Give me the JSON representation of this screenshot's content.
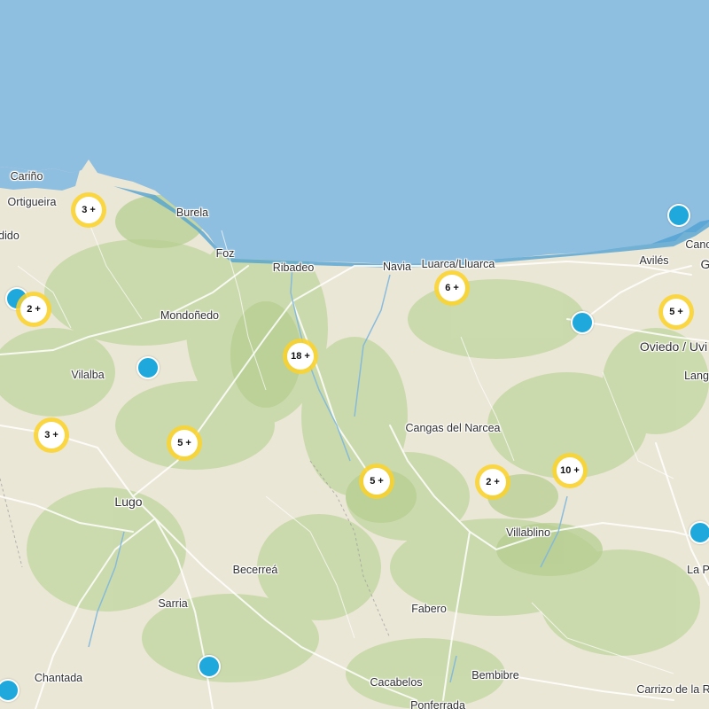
{
  "map": {
    "colors": {
      "sea": "#8fbfe0",
      "coast_sea": "#4b9fd3",
      "land": "#ebe7d6",
      "vegetation": "#c8d9a9",
      "cluster": "#fdd228",
      "pin": "#1fa8dc"
    },
    "places": [
      {
        "name": "Cariño",
        "size": "normal"
      },
      {
        "name": "Ortigueira",
        "size": "normal"
      },
      {
        "name": "Burela",
        "size": "normal"
      },
      {
        "name": "dido",
        "size": "normal"
      },
      {
        "name": "Foz",
        "size": "normal"
      },
      {
        "name": "Ribadeo",
        "size": "normal"
      },
      {
        "name": "Navia",
        "size": "normal"
      },
      {
        "name": "Luarca/Lluarca",
        "size": "normal"
      },
      {
        "name": "Avilés",
        "size": "normal"
      },
      {
        "name": "Canc",
        "size": "normal"
      },
      {
        "name": "G",
        "size": "big"
      },
      {
        "name": "Mondoñedo",
        "size": "normal"
      },
      {
        "name": "Oviedo / Uvi",
        "size": "big"
      },
      {
        "name": "Vilalba",
        "size": "normal"
      },
      {
        "name": "Lang",
        "size": "normal"
      },
      {
        "name": "Cangas del Narcea",
        "size": "normal"
      },
      {
        "name": "Lugo",
        "size": "big"
      },
      {
        "name": "Villablino",
        "size": "normal"
      },
      {
        "name": "Becerreá",
        "size": "normal"
      },
      {
        "name": "La P",
        "size": "normal"
      },
      {
        "name": "Sarria",
        "size": "normal"
      },
      {
        "name": "Fabero",
        "size": "normal"
      },
      {
        "name": "Chantada",
        "size": "normal"
      },
      {
        "name": "Bembibre",
        "size": "normal"
      },
      {
        "name": "Cacabelos",
        "size": "normal"
      },
      {
        "name": "Carrizo de la R",
        "size": "normal"
      },
      {
        "name": "Ponferrada",
        "size": "normal"
      }
    ],
    "clusters": [
      "3 +",
      "2 +",
      "6 +",
      "5 +",
      "18 +",
      "3 +",
      "5 +",
      "10 +",
      "5 +",
      "2 +"
    ],
    "pins": 8
  }
}
